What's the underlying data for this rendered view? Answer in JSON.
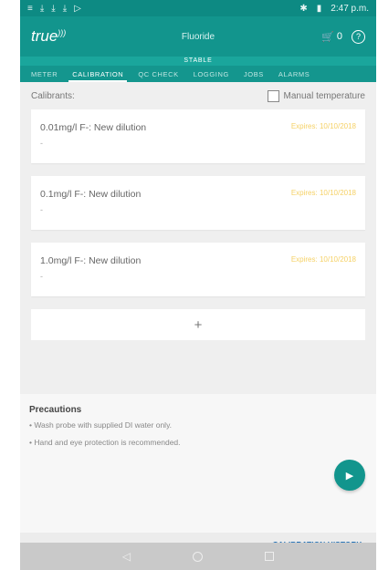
{
  "status_bar": {
    "notifications": [
      "≡",
      "⤓",
      "⤓",
      "⤓",
      "▷"
    ],
    "time": "2:47 p.m."
  },
  "app_bar": {
    "logo_text": "true",
    "title": "Fluoride",
    "cart_count": "0",
    "help_symbol": "?"
  },
  "stability": "STABLE",
  "tabs": [
    {
      "label": "METER",
      "active": false
    },
    {
      "label": "CALIBRATION",
      "active": true
    },
    {
      "label": "QC CHECK",
      "active": false
    },
    {
      "label": "LOGGING",
      "active": false
    },
    {
      "label": "JOBS",
      "active": false
    },
    {
      "label": "ALARMS",
      "active": false
    }
  ],
  "calibration": {
    "calibrants_label": "Calibrants:",
    "manual_temperature_label": "Manual temperature",
    "manual_temperature_checked": false,
    "items": [
      {
        "name": "0.01mg/l F-: New dilution",
        "expiry": "Expires: 10/10/2018",
        "detail": "-"
      },
      {
        "name": "0.1mg/l F-: New dilution",
        "expiry": "Expires: 10/10/2018",
        "detail": "-"
      },
      {
        "name": "1.0mg/l F-: New dilution",
        "expiry": "Expires: 10/10/2018",
        "detail": "-"
      }
    ],
    "add_symbol": "+"
  },
  "precautions": {
    "title": "Precautions",
    "items": [
      "• Wash probe with supplied DI water only.",
      "• Hand and eye protection is recommended."
    ]
  },
  "fab_symbol": "▶",
  "calibration_history_label": "CALIBRATION HISTORY",
  "colors": {
    "primary": "#12958d",
    "expiry": "#f4c94c",
    "link": "#1e6fb5"
  }
}
